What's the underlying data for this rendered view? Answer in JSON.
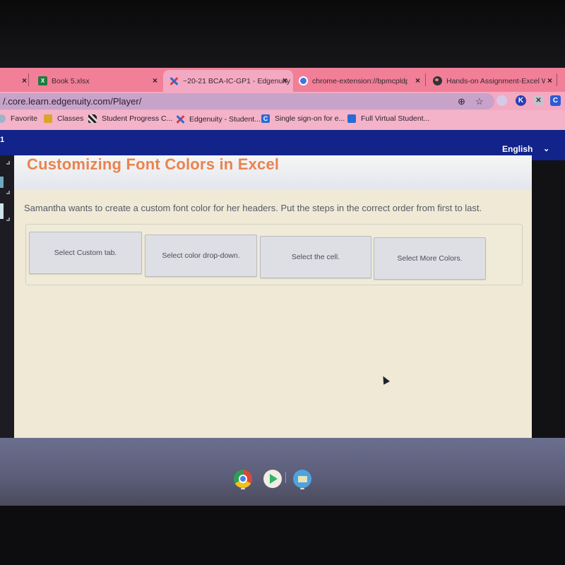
{
  "browser": {
    "tabs": [
      {
        "label": "",
        "icon": "close-icon",
        "active": false
      },
      {
        "label": "Book 5.xlsx",
        "icon": "excel-icon",
        "active": false
      },
      {
        "label": "~20-21 BCA-IC-GP1 - Edgenuity",
        "icon": "edgenuity-icon",
        "active": true
      },
      {
        "label": "chrome-extension://bpmcpldpd",
        "icon": "chrome-extension-icon",
        "active": false
      },
      {
        "label": "Hands-on Assignment-Excel Wo",
        "icon": "globe-icon",
        "active": false
      }
    ],
    "close_glyph": "×",
    "url": "/.core.learn.edgenuity.com/Player/",
    "omnibox_icons": {
      "zoom": "⊕",
      "star": "☆"
    },
    "extensions": [
      {
        "name": "extension-profile-icon",
        "glyph": ""
      },
      {
        "name": "extension-k-icon",
        "glyph": "K"
      },
      {
        "name": "extension-x-icon",
        "glyph": "✕"
      },
      {
        "name": "extension-c-icon",
        "glyph": "C"
      }
    ],
    "bookmarks": [
      {
        "label": "Favorite"
      },
      {
        "label": "Classes"
      },
      {
        "label": "Student Progress C..."
      },
      {
        "label": "Edgenuity - Student..."
      },
      {
        "label": "Single sign-on for e..."
      },
      {
        "label": "Full Virtual Student..."
      }
    ]
  },
  "app": {
    "header_number": "1",
    "language": "English",
    "language_chevron": "⌄"
  },
  "activity": {
    "title": "Customizing Font Colors in Excel",
    "prompt": "Samantha wants to create a custom font color for her headers. Put the steps in the correct order from first to last.",
    "cards": [
      {
        "label": "Select Custom tab."
      },
      {
        "label": "Select color drop-down."
      },
      {
        "label": "Select the cell."
      },
      {
        "label": "Select More Colors."
      }
    ]
  },
  "shelf": {
    "apps": [
      "Chrome",
      "Play Store",
      "Files"
    ]
  },
  "colors": {
    "tab_strip": "#f07f97",
    "app_header": "#12238a",
    "title": "#e98350",
    "panel_bg": "#efe9d6"
  }
}
